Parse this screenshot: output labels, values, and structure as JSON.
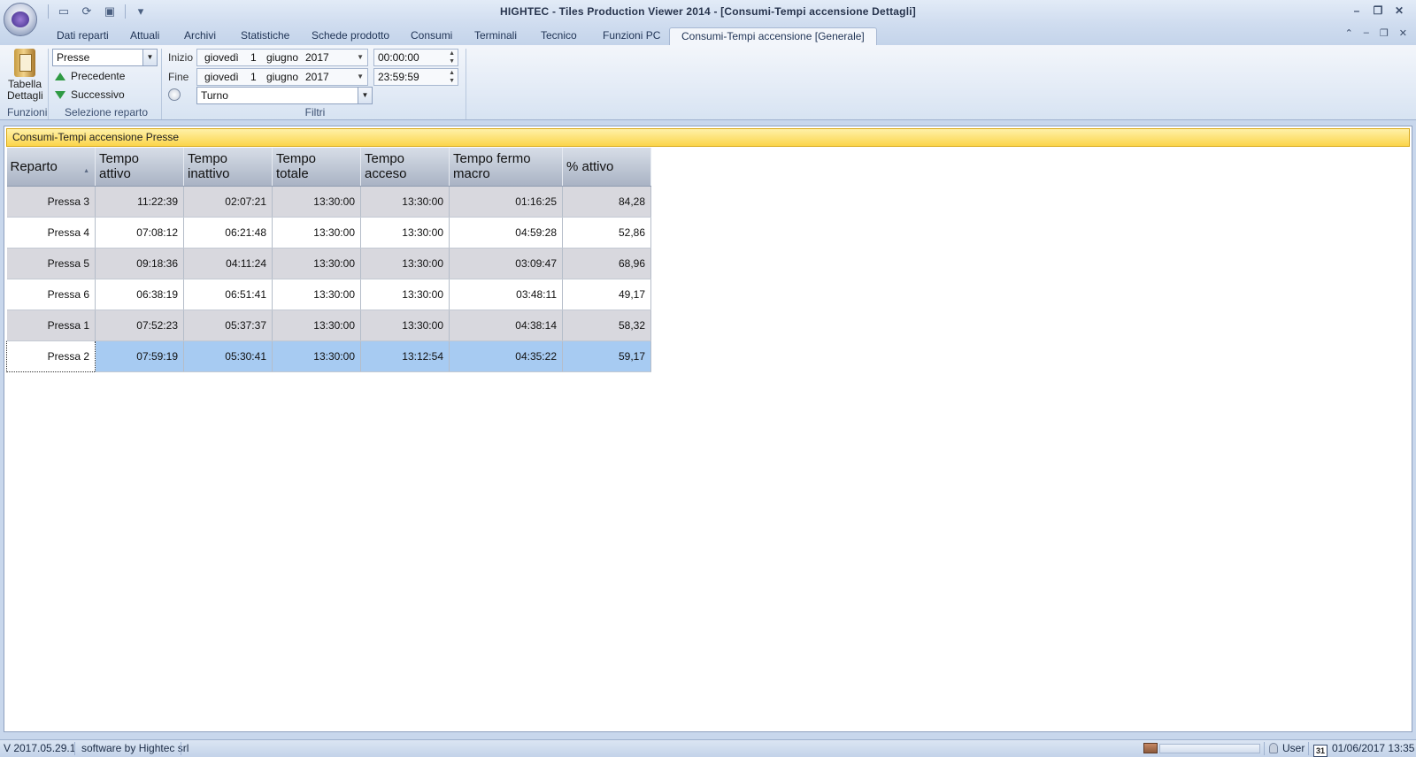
{
  "window": {
    "title": "HIGHTEC - Tiles Production Viewer 2014 - [Consumi-Tempi accensione Dettagli]"
  },
  "tabs": [
    {
      "label": "Dati reparti"
    },
    {
      "label": "Attuali"
    },
    {
      "label": "Archivi"
    },
    {
      "label": "Statistiche"
    },
    {
      "label": "Schede prodotto"
    },
    {
      "label": "Consumi"
    },
    {
      "label": "Terminali"
    },
    {
      "label": "Tecnico"
    },
    {
      "label": "Funzioni PC"
    },
    {
      "label": "Consumi-Tempi accensione [Generale]",
      "active": true
    }
  ],
  "ribbon": {
    "funzioni": {
      "button_line1": "Tabella",
      "button_line2": "Dettagli",
      "group_label": "Funzioni"
    },
    "selezione": {
      "reparto_value": "Presse",
      "prev_label": "Precedente",
      "next_label": "Successivo",
      "group_label": "Selezione reparto"
    },
    "filtri": {
      "start_label": "Inizio",
      "start_weekday": "giovedì",
      "start_day": "1",
      "start_month": "giugno",
      "start_year": "2017",
      "start_time": "00:00:00",
      "end_label": "Fine",
      "end_weekday": "giovedì",
      "end_day": "1",
      "end_month": "giugno",
      "end_year": "2017",
      "end_time": "23:59:59",
      "turno_value": "Turno",
      "group_label": "Filtri"
    }
  },
  "panel": {
    "title": "Consumi-Tempi accensione Presse"
  },
  "table": {
    "columns": [
      {
        "line1": "Reparto",
        "line2": ""
      },
      {
        "line1": "Tempo",
        "line2": "attivo"
      },
      {
        "line1": "Tempo",
        "line2": "inattivo"
      },
      {
        "line1": "Tempo",
        "line2": "totale"
      },
      {
        "line1": "Tempo",
        "line2": "acceso"
      },
      {
        "line1": "Tempo fermo",
        "line2": "macro"
      },
      {
        "line1": "% attivo",
        "line2": ""
      }
    ],
    "rows": [
      [
        "Pressa 3",
        "11:22:39",
        "02:07:21",
        "13:30:00",
        "13:30:00",
        "01:16:25",
        "84,28"
      ],
      [
        "Pressa 4",
        "07:08:12",
        "06:21:48",
        "13:30:00",
        "13:30:00",
        "04:59:28",
        "52,86"
      ],
      [
        "Pressa 5",
        "09:18:36",
        "04:11:24",
        "13:30:00",
        "13:30:00",
        "03:09:47",
        "68,96"
      ],
      [
        "Pressa 6",
        "06:38:19",
        "06:51:41",
        "13:30:00",
        "13:30:00",
        "03:48:11",
        "49,17"
      ],
      [
        "Pressa 1",
        "07:52:23",
        "05:37:37",
        "13:30:00",
        "13:30:00",
        "04:38:14",
        "58,32"
      ],
      [
        "Pressa 2",
        "07:59:19",
        "05:30:41",
        "13:30:00",
        "13:12:54",
        "04:35:22",
        "59,17"
      ]
    ],
    "selected_row": 5
  },
  "status": {
    "version": "V 2017.05.29.1",
    "credit": "software by Hightec srl",
    "user": "User",
    "calendar_day": "31",
    "datetime": "01/06/2017 13:35"
  },
  "colors": {
    "panel_header": "#fbd54b",
    "selection": "#a7cbf2",
    "ribbon_bg": "#e3ebf6"
  }
}
